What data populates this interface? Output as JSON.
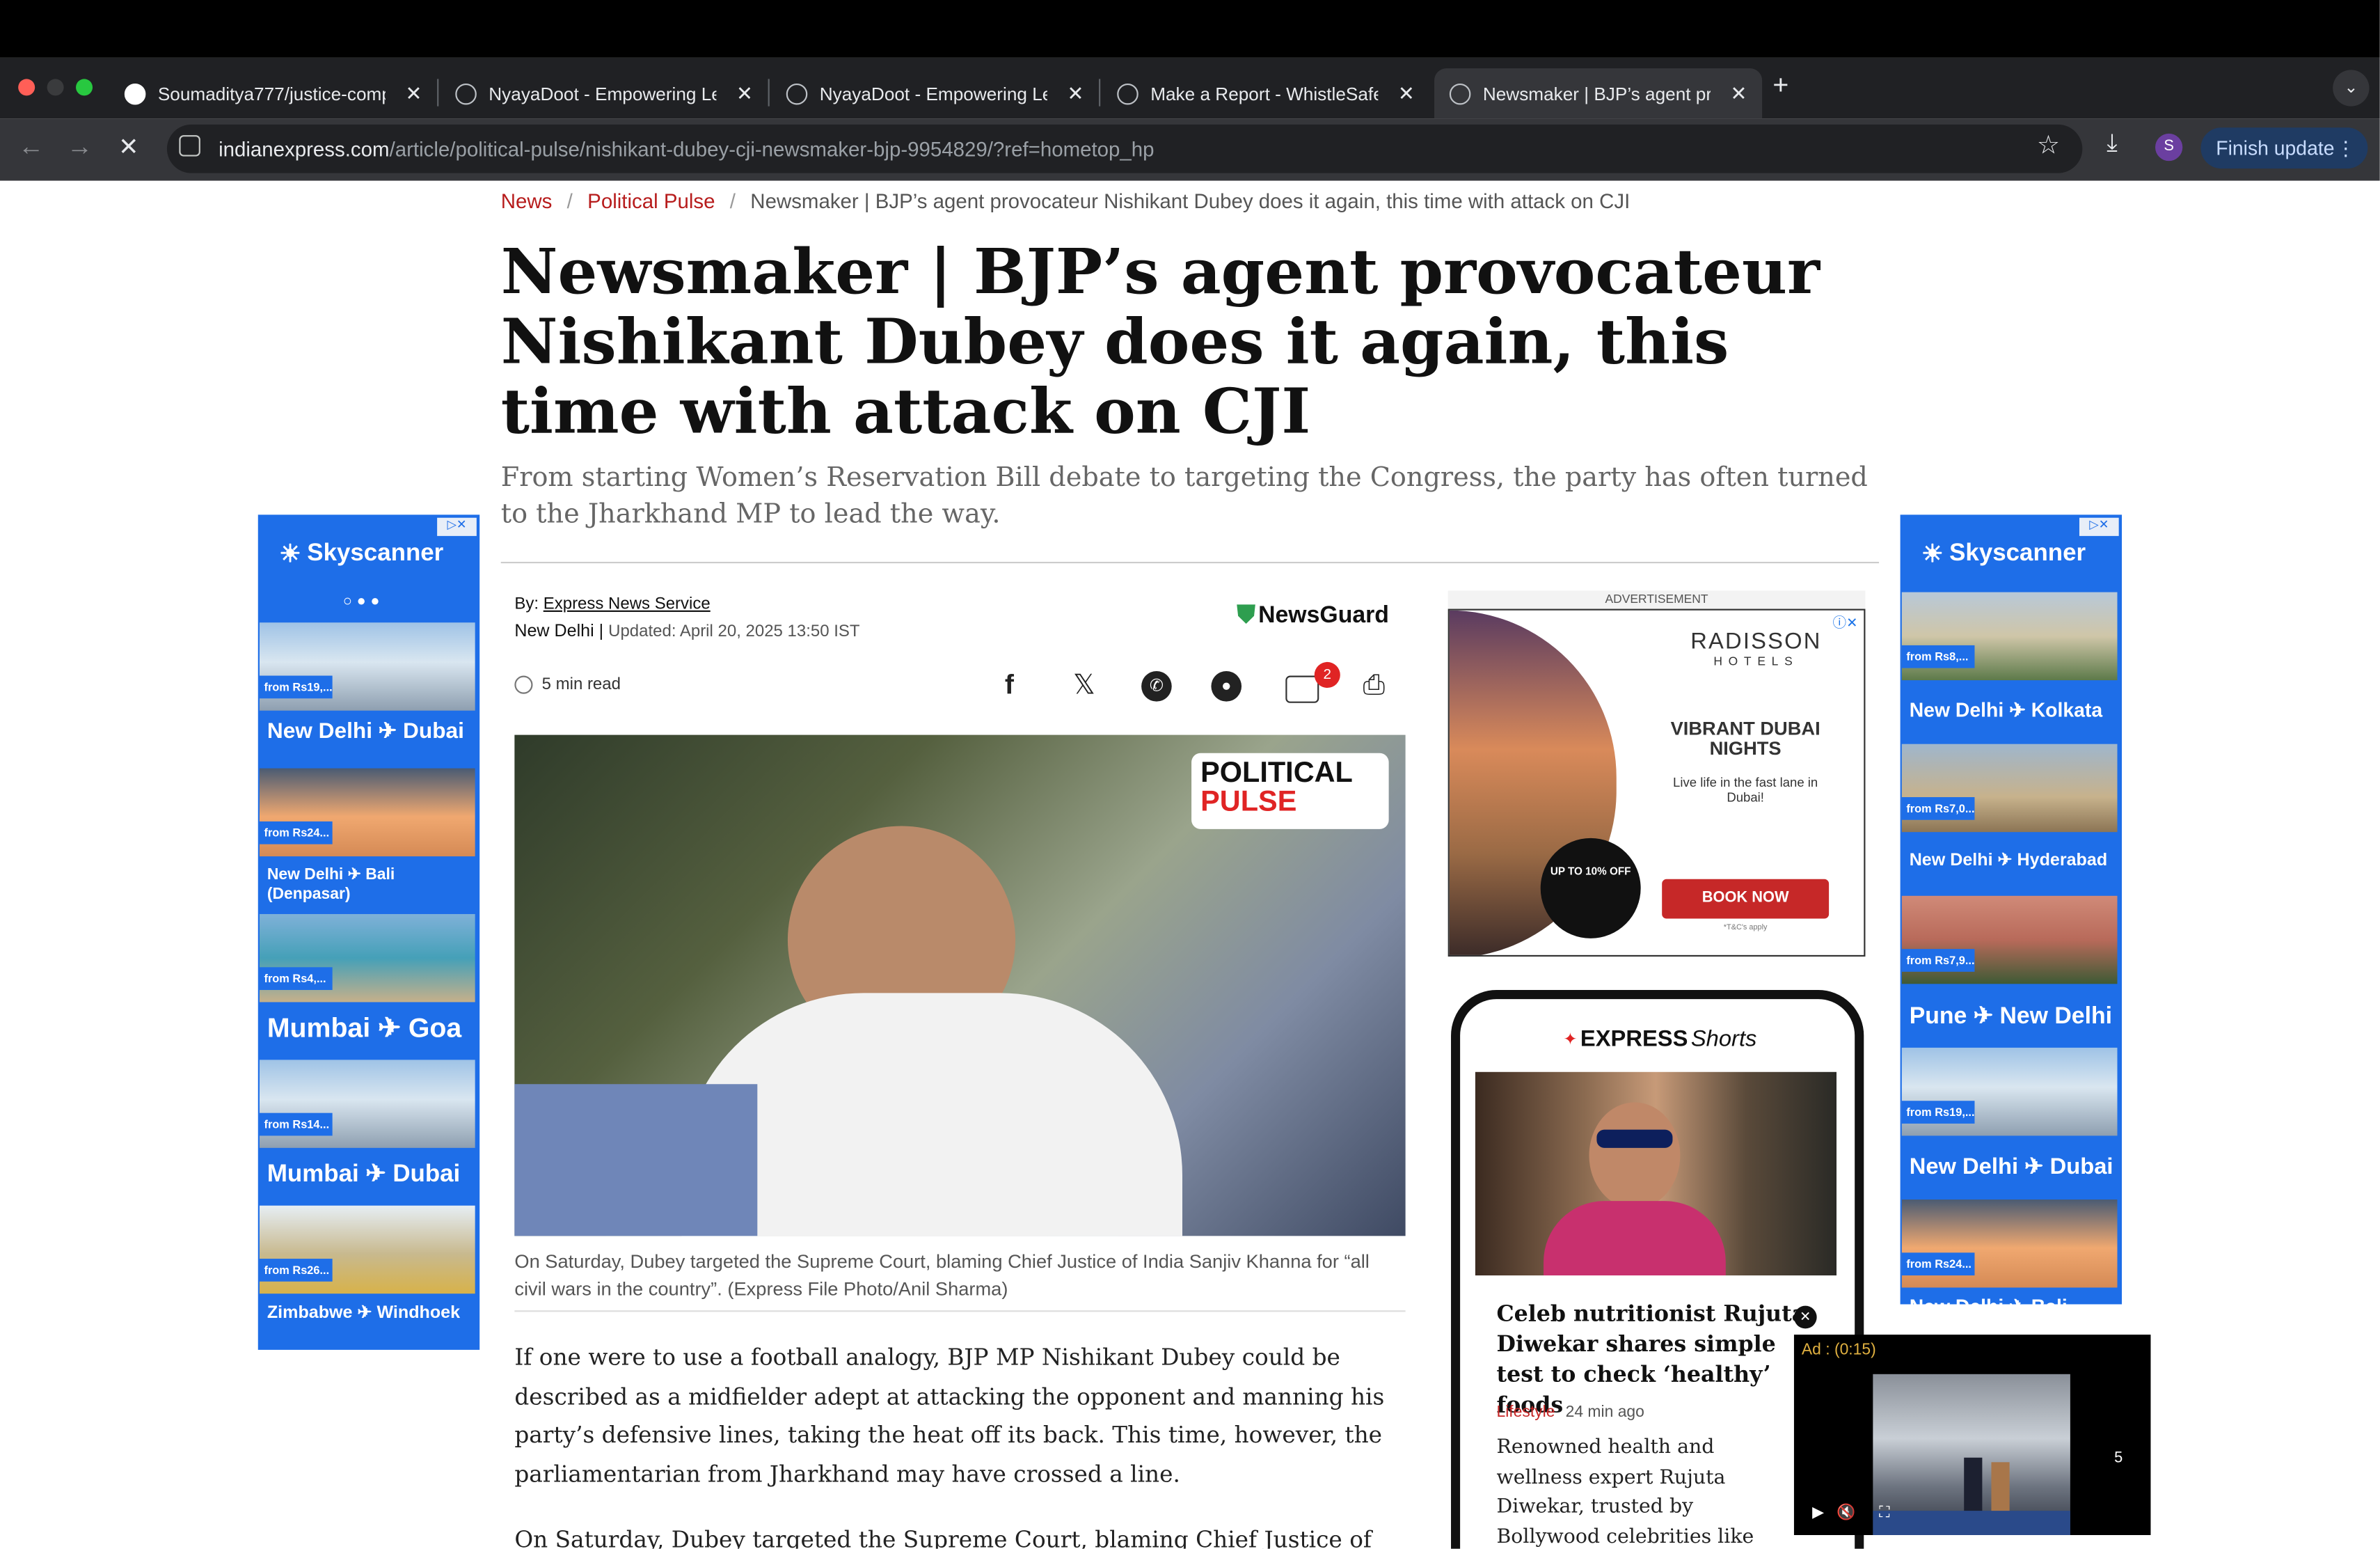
{
  "browser": {
    "tabs": [
      {
        "title": "Soumaditya777/justice-comp",
        "icon": "github-icon"
      },
      {
        "title": "NyayaDoot - Empowering Leg",
        "icon": "globe-icon"
      },
      {
        "title": "NyayaDoot - Empowering Leg",
        "icon": "globe-icon"
      },
      {
        "title": "Make a Report - WhistleSafe",
        "icon": "globe-icon"
      },
      {
        "title": "Newsmaker | BJP’s agent pro",
        "icon": "globe-icon",
        "active": true
      }
    ],
    "new_tab": "+",
    "close": "✕",
    "url_host": "indianexpress.com",
    "url_path": "/article/political-pulse/nishikant-dubey-cji-newsmaker-bjp-9954829/?ref=hometop_hp",
    "profile_initial": "S",
    "finish_update": "Finish update"
  },
  "article": {
    "breadcrumb": [
      "News",
      "Political Pulse",
      "Newsmaker | BJP’s agent provocateur Nishikant Dubey does it again, this time with attack on CJI"
    ],
    "breadcrumb_sep": "/",
    "headline": "Newsmaker | BJP’s agent provocateur Nishikant Dubey does it again, this time with attack on CJI",
    "subhead": "From starting Women’s Reservation Bill debate to targeting the Congress, the party has often turned to the Jharkhand MP to lead the way.",
    "by_label": "By:",
    "author": "Express News Service",
    "location": "New Delhi |",
    "updated": "Updated: April 20, 2025 13:50 IST",
    "newsguard": "NewsGuard",
    "read_time": "5 min read",
    "comment_count": "2",
    "image_badge_line1": "POLITICAL",
    "image_badge_line2": "PULSE",
    "caption": "On Saturday, Dubey targeted the Supreme Court, blaming Chief Justice of India Sanjiv Khanna for “all civil wars in the country”. (Express File Photo/Anil Sharma)",
    "para1": "If one were to use a football analogy, BJP MP Nishikant Dubey could be described as a midfielder adept at attacking the opponent and manning his party’s defensive lines, taking the heat off its back. This time, however, the parliamentarian from Jharkhand may have crossed a line.",
    "para2": "On Saturday, Dubey targeted the Supreme Court, blaming Chief Justice of India"
  },
  "left_ad": {
    "brand": "Skyscanner",
    "items": [
      {
        "price": "from Rs19,...",
        "route": "New Delhi ✈ Dubai"
      },
      {
        "price": "from Rs24...",
        "route": "New Delhi ✈ Bali (Denpasar)"
      },
      {
        "price": "from Rs4,...",
        "route": "Mumbai ✈ Goa"
      },
      {
        "price": "from Rs14...",
        "route": "Mumbai ✈ Dubai"
      },
      {
        "price": "from Rs26...",
        "route": "Zimbabwe ✈ Windhoek"
      }
    ]
  },
  "right_ad": {
    "brand": "Skyscanner",
    "items": [
      {
        "price": "from Rs8,...",
        "route": "New Delhi ✈ Kolkata"
      },
      {
        "price": "from Rs7,0...",
        "route": "New Delhi ✈ Hyderabad"
      },
      {
        "price": "from Rs7,9...",
        "route": "Pune ✈ New Delhi"
      },
      {
        "price": "from Rs19,...",
        "route": "New Delhi ✈ Dubai"
      },
      {
        "price": "from Rs24...",
        "route": "New Delhi ✈ Bali"
      }
    ]
  },
  "radisson_ad": {
    "label": "ADVERTISEMENT",
    "brand": "RADISSON",
    "brand_sub": "HOTELS",
    "headline": "VIBRANT DUBAI NIGHTS",
    "text": "Live life in the fast lane in Dubai!",
    "offer": "UP TO 10% OFF",
    "cta": "BOOK NOW",
    "terms": "*T&C's apply"
  },
  "shorts": {
    "brand": "EXPRESS",
    "brand_suffix": "Shorts",
    "title": "Celeb nutritionist Rujuta Diwekar shares simple test to check ‘healthy’ foods",
    "category": "Lifestyle",
    "time": "24 min ago",
    "excerpt": "Renowned health and wellness expert Rujuta Diwekar, trusted by Bollywood celebrities like Kareena and Karisma Kapoor,"
  },
  "video_ad": {
    "label": "Ad : (0:15)",
    "countdown": "5"
  },
  "colors": {
    "accent_red": "#b71c1c",
    "sky_blue": "#1e6ee8",
    "chrome_dark": "#202124",
    "update_btn": "#1f3b63"
  }
}
